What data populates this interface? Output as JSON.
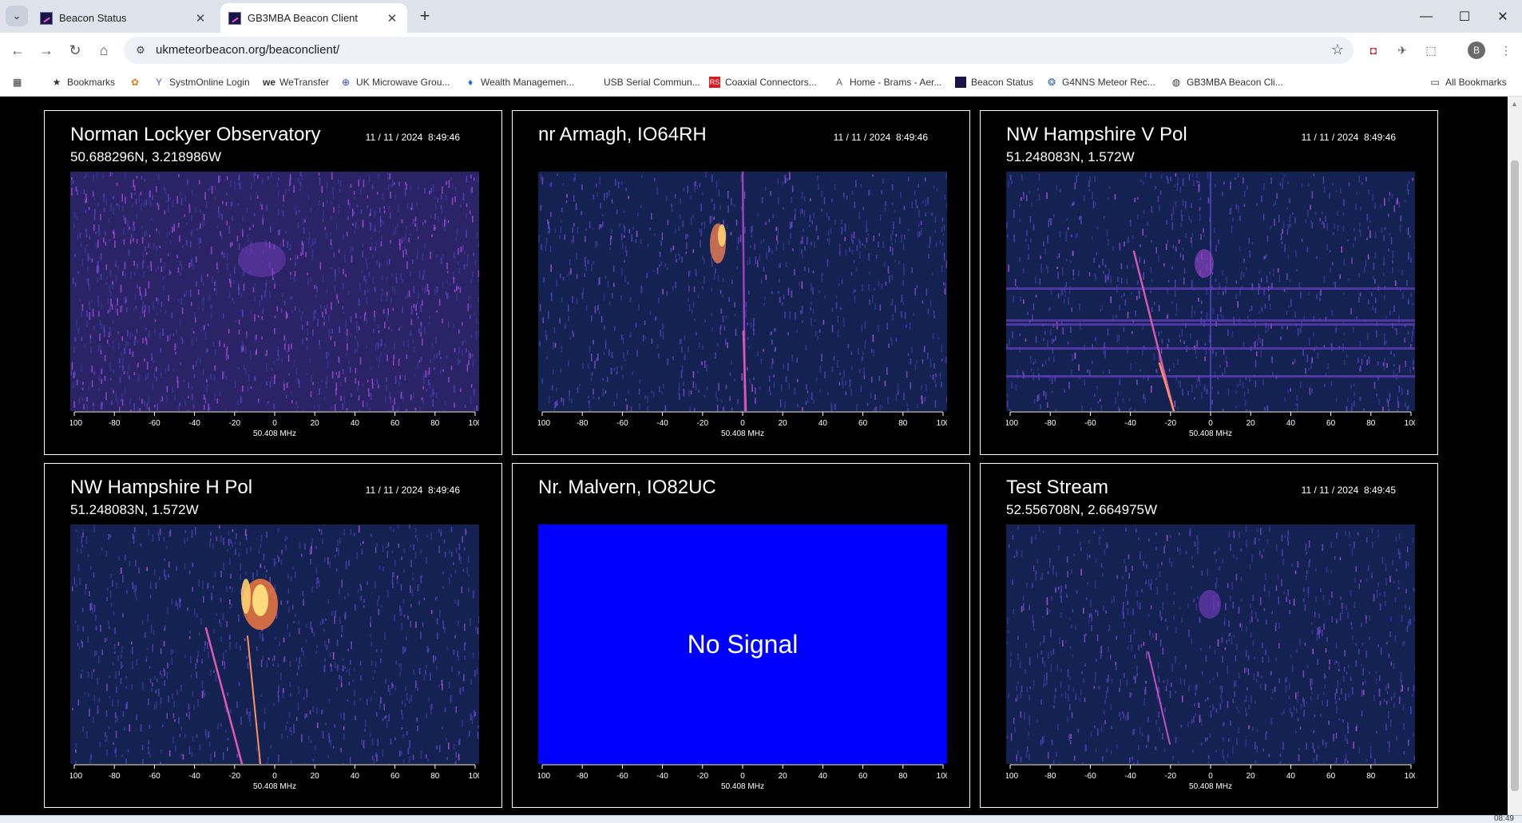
{
  "browser": {
    "tabs": [
      {
        "label": "Beacon Status",
        "active": false
      },
      {
        "label": "GB3MBA Beacon Client",
        "active": true
      }
    ],
    "url": "ukmeteorbeacon.org/beaconclient/",
    "profile_initial": "B",
    "bookmarks": [
      {
        "label": "Bookmarks",
        "icon": "star-icon"
      },
      {
        "label": "SystmOnline Login",
        "icon": "systmonline-icon"
      },
      {
        "label": "WeTransfer",
        "icon": "wetransfer-icon"
      },
      {
        "label": "UK Microwave Grou...",
        "icon": "microwave-group-icon"
      },
      {
        "label": "Wealth Managemen...",
        "icon": "wealth-icon"
      },
      {
        "label": "USB Serial Commun...",
        "icon": ""
      },
      {
        "label": "Coaxial Connectors...",
        "icon": "rs-icon"
      },
      {
        "label": "Home - Brams - Aer...",
        "icon": "brams-icon"
      },
      {
        "label": "Beacon Status",
        "icon": "beacon-icon"
      },
      {
        "label": "G4NNS Meteor Rec...",
        "icon": "g4nns-icon"
      },
      {
        "label": "GB3MBA Beacon Cli...",
        "icon": "globe-icon"
      },
      {
        "label": "All Bookmarks",
        "icon": "folder-icon"
      }
    ]
  },
  "axis": {
    "ticks": [
      "-100",
      "-80",
      "-60",
      "-40",
      "-20",
      "0",
      "20",
      "40",
      "60",
      "80",
      "100"
    ],
    "unit_label": "50.408 MHz"
  },
  "panels": [
    {
      "title": "Norman Lockyer Observatory",
      "time": "11 / 11 / 2024  8:49:46",
      "coords": "50.688296N, 3.218986W",
      "signal": true
    },
    {
      "title": "nr Armagh, IO64RH",
      "time": "11 / 11 / 2024  8:49:46",
      "coords": "",
      "signal": true
    },
    {
      "title": "NW Hampshire V Pol",
      "time": "11 / 11 / 2024  8:49:46",
      "coords": "51.248083N, 1.572W",
      "signal": true
    },
    {
      "title": "NW Hampshire H Pol",
      "time": "11 / 11 / 2024  8:49:46",
      "coords": "51.248083N, 1.572W",
      "signal": true
    },
    {
      "title": "Nr. Malvern, IO82UC",
      "time": "",
      "coords": "",
      "signal": false,
      "no_signal_text": "No Signal"
    },
    {
      "title": "Test Stream",
      "time": "11 / 11 / 2024  8:49:45",
      "coords": "52.556708N, 2.664975W",
      "signal": true
    }
  ],
  "taskbar": {
    "clock": "08:49"
  },
  "colors": {
    "waterfall_bg": "#16214f",
    "no_signal_bg": "#0000ff",
    "accent_magenta": "#d24fe0"
  }
}
